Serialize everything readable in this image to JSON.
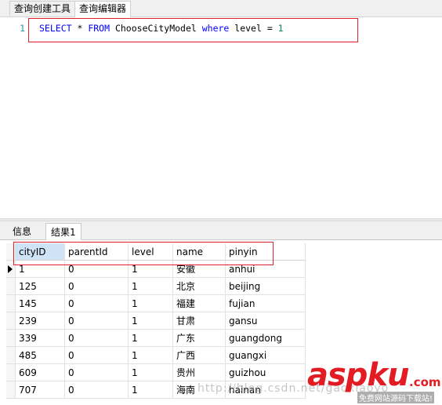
{
  "top_tabs": [
    "查询创建工具",
    "查询编辑器"
  ],
  "editor": {
    "line_number": "1",
    "sql": {
      "select": "SELECT",
      "star": " * ",
      "from": "FROM",
      "table": " ChooseCityModel ",
      "where": "where",
      "condition": " level = ",
      "value": "1"
    }
  },
  "result_tabs": [
    "信息",
    "结果1"
  ],
  "grid": {
    "columns": [
      "cityID",
      "parentId",
      "level",
      "name",
      "pinyin"
    ],
    "rows": [
      [
        "1",
        "0",
        "1",
        "安徽",
        "anhui"
      ],
      [
        "125",
        "0",
        "1",
        "北京",
        "beijing"
      ],
      [
        "145",
        "0",
        "1",
        "福建",
        "fujian"
      ],
      [
        "239",
        "0",
        "1",
        "甘肃",
        "gansu"
      ],
      [
        "339",
        "0",
        "1",
        "广东",
        "guangdong"
      ],
      [
        "485",
        "0",
        "1",
        "广西",
        "guangxi"
      ],
      [
        "609",
        "0",
        "1",
        "贵州",
        "guizhou"
      ],
      [
        "707",
        "0",
        "1",
        "海南",
        "hainan"
      ]
    ]
  },
  "watermark": "http://blog.csdn.net/gaoxiaoyo",
  "logo": {
    "main": "aspku",
    "com": ".com",
    "sub": "免费网站源码下载站!"
  },
  "colors": {
    "keyword": "#0000ff",
    "number": "#098658",
    "highlight": "#e0202a",
    "header_selected": "#cfe3f7"
  }
}
